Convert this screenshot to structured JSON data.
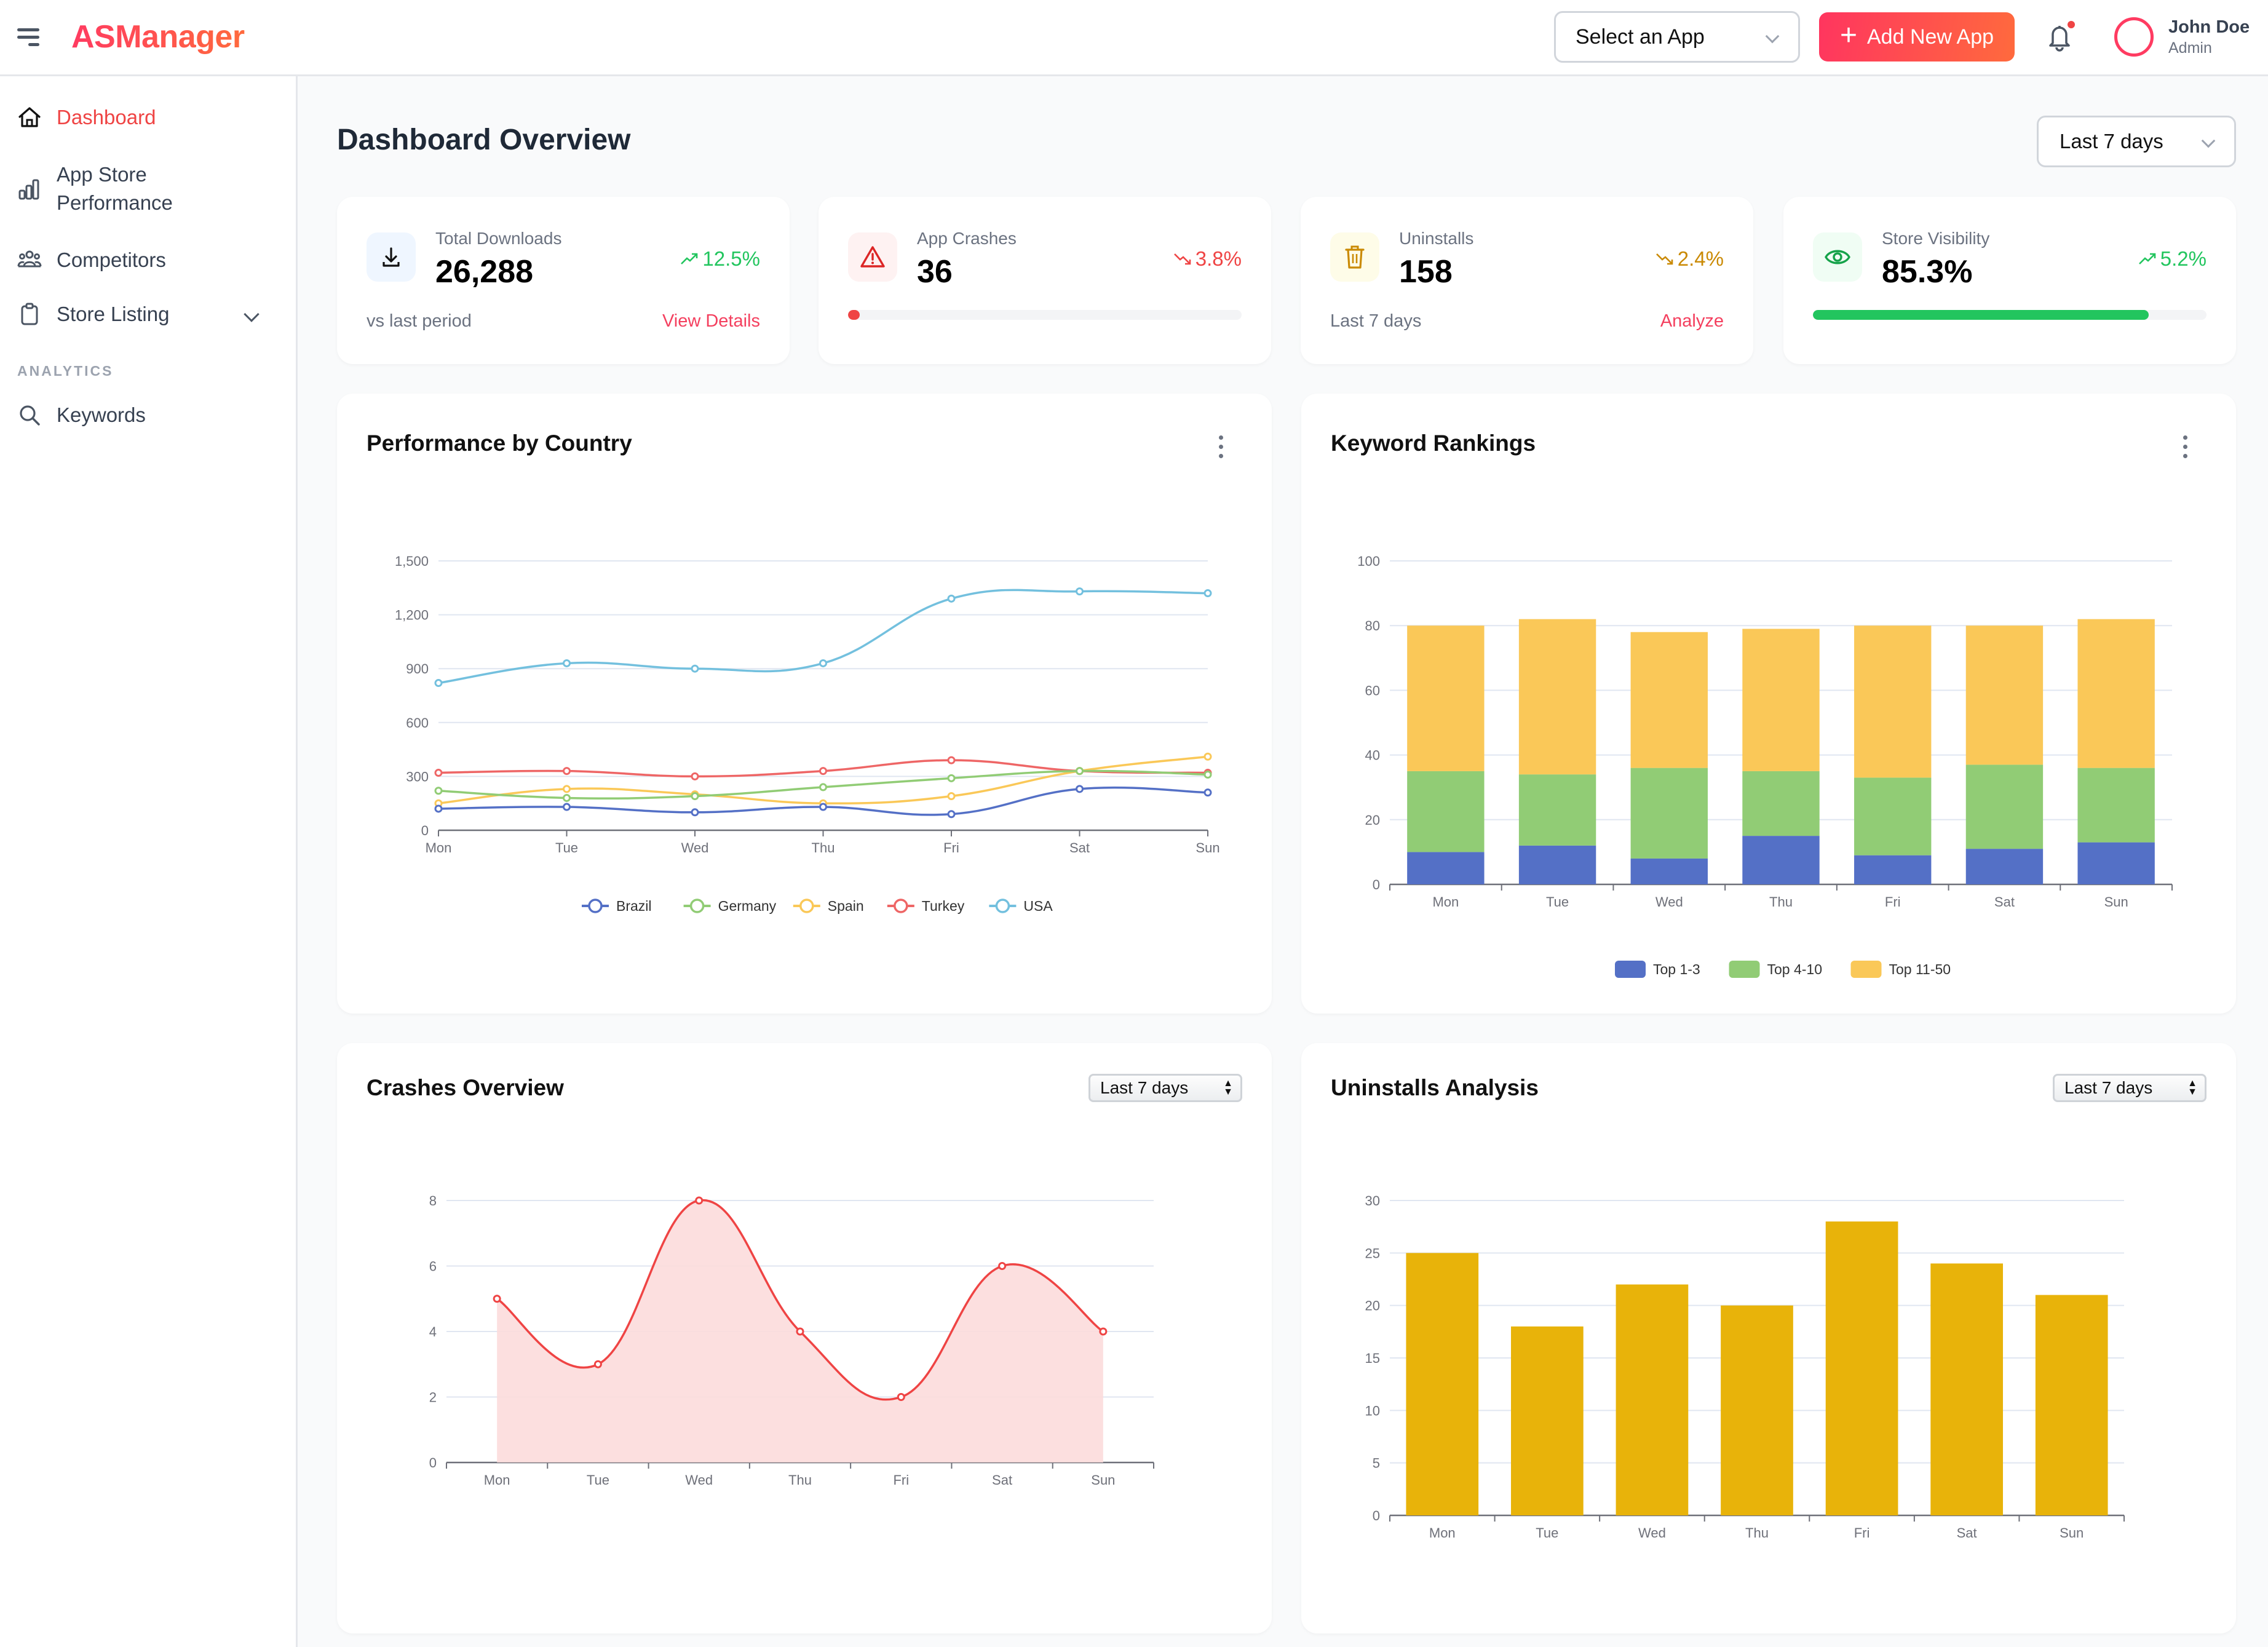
{
  "app": {
    "title": "ASManager",
    "menu_icon": "hamburger-menu-icon"
  },
  "header": {
    "app_select": {
      "value": "Select an App",
      "icon": "chevron-down-icon"
    },
    "add_button": {
      "label": "Add New App",
      "icon": "plus-icon"
    },
    "notifications": {
      "icon": "bell-icon",
      "has_unread": true,
      "badge_color": "#ef4444"
    },
    "user": {
      "name": "John Doe",
      "role": "Admin",
      "avatar_ring_color": "#ff3b61"
    }
  },
  "sidebar": {
    "items": [
      {
        "label": "Dashboard",
        "icon": "home-icon",
        "active": true
      },
      {
        "label": "App Store Performance",
        "line1": "App Store",
        "line2": "Performance",
        "icon": "bar-chart-icon",
        "active": false
      },
      {
        "label": "Competitors",
        "icon": "users-group-icon",
        "active": false
      },
      {
        "label": "Store Listing",
        "icon": "clipboard-icon",
        "active": false,
        "expandable": true
      }
    ],
    "section_label": "ANALYTICS",
    "section_items": [
      {
        "label": "Keywords",
        "icon": "search-icon"
      }
    ],
    "active_color": "#ef4444"
  },
  "main": {
    "title": "Dashboard Overview",
    "range_select": "Last 7 days",
    "stats": [
      {
        "label": "Total Downloads",
        "value": "26,288",
        "trend": "12.5%",
        "trend_dir": "up",
        "trend_color": "#22c55e",
        "icon": "download-icon",
        "icon_color": "#111111",
        "icon_bg": "#eff6ff",
        "footer": "vs last period",
        "link": "View Details"
      },
      {
        "label": "App Crashes",
        "value": "36",
        "trend": "3.8%",
        "trend_dir": "down",
        "trend_color": "#ef4444",
        "icon": "warning-triangle-icon",
        "icon_color": "#dc2626",
        "icon_bg": "#fef2f2",
        "progress_percent": 3,
        "progress_color": "#ef4444"
      },
      {
        "label": "Uninstalls",
        "value": "158",
        "trend": "2.4%",
        "trend_dir": "down",
        "trend_color": "#ca8a04",
        "icon": "trash-icon",
        "icon_color": "#ca8a04",
        "icon_bg": "#fefce8",
        "footer": "Last 7 days",
        "link": "Analyze"
      },
      {
        "label": "Store Visibility",
        "value": "85.3%",
        "trend": "5.2%",
        "trend_dir": "up",
        "trend_color": "#22c55e",
        "icon": "eye-icon",
        "icon_color": "#16a34a",
        "icon_bg": "#f0fdf4",
        "progress_percent": 85.3,
        "progress_color": "#22c55e"
      }
    ],
    "link_color": "#f43f5e"
  },
  "chart_data": [
    {
      "id": "country",
      "type": "line",
      "title": "Performance by Country",
      "menu_icon": "kebab-menu-icon",
      "categories": [
        "Mon",
        "Tue",
        "Wed",
        "Thu",
        "Fri",
        "Sat",
        "Sun"
      ],
      "series": [
        {
          "name": "Brazil",
          "color": "#5470c6",
          "values": [
            120,
            130,
            100,
            130,
            90,
            230,
            210
          ]
        },
        {
          "name": "Germany",
          "color": "#91cc75",
          "values": [
            220,
            180,
            190,
            240,
            290,
            330,
            310
          ]
        },
        {
          "name": "Spain",
          "color": "#fac858",
          "values": [
            150,
            230,
            200,
            150,
            190,
            330,
            410
          ]
        },
        {
          "name": "Turkey",
          "color": "#ee6666",
          "values": [
            320,
            330,
            300,
            330,
            390,
            330,
            320
          ]
        },
        {
          "name": "USA",
          "color": "#73c0de",
          "values": [
            820,
            930,
            900,
            930,
            1290,
            1330,
            1320
          ]
        }
      ],
      "yticks": [
        "0",
        "300",
        "600",
        "900",
        "1,200",
        "1,500"
      ],
      "ylim": [
        0,
        1500
      ],
      "grid": true,
      "smooth": true,
      "legend_position": "bottom"
    },
    {
      "id": "keywords",
      "type": "bar",
      "stacked": true,
      "title": "Keyword Rankings",
      "menu_icon": "kebab-menu-icon",
      "categories": [
        "Mon",
        "Tue",
        "Wed",
        "Thu",
        "Fri",
        "Sat",
        "Sun"
      ],
      "series": [
        {
          "name": "Top 1-3",
          "color": "#5470c6",
          "values": [
            10,
            12,
            8,
            15,
            9,
            11,
            13
          ]
        },
        {
          "name": "Top 4-10",
          "color": "#91cc75",
          "values": [
            25,
            22,
            28,
            20,
            24,
            26,
            23
          ]
        },
        {
          "name": "Top 11-50",
          "color": "#fac858",
          "values": [
            45,
            48,
            42,
            44,
            47,
            43,
            46
          ]
        }
      ],
      "yticks": [
        "0",
        "20",
        "40",
        "60",
        "80",
        "100"
      ],
      "ylim": [
        0,
        100
      ],
      "grid": true,
      "legend_position": "bottom"
    },
    {
      "id": "crashes",
      "type": "area",
      "title": "Crashes Overview",
      "range_select": "Last 7 days",
      "categories": [
        "Mon",
        "Tue",
        "Wed",
        "Thu",
        "Fri",
        "Sat",
        "Sun"
      ],
      "series": [
        {
          "name": "Crashes",
          "color": "#ef4444",
          "fill": "#fcdcdc",
          "values": [
            5,
            3,
            8,
            4,
            2,
            6,
            4
          ]
        }
      ],
      "yticks": [
        "0",
        "2",
        "4",
        "6",
        "8"
      ],
      "ylim": [
        0,
        8
      ],
      "grid": true,
      "smooth": true
    },
    {
      "id": "uninstalls",
      "type": "bar",
      "title": "Uninstalls Analysis",
      "range_select": "Last 7 days",
      "categories": [
        "Mon",
        "Tue",
        "Wed",
        "Thu",
        "Fri",
        "Sat",
        "Sun"
      ],
      "series": [
        {
          "name": "Uninstalls",
          "color": "#e8b30a",
          "values": [
            25,
            18,
            22,
            20,
            28,
            24,
            21
          ]
        }
      ],
      "yticks": [
        "0",
        "5",
        "10",
        "15",
        "20",
        "25",
        "30"
      ],
      "ylim": [
        0,
        30
      ],
      "grid": true
    }
  ]
}
